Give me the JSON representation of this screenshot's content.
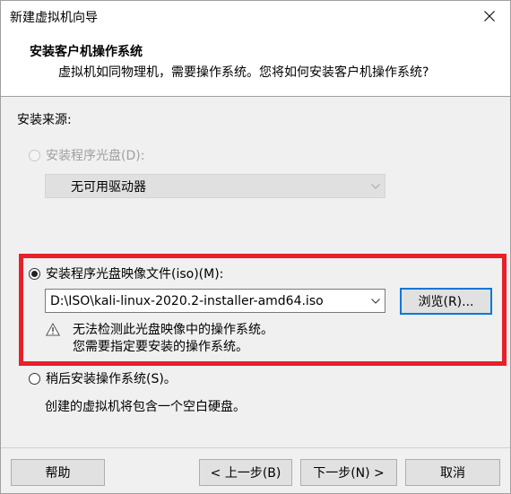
{
  "window": {
    "title": "新建虚拟机向导"
  },
  "header": {
    "title": "安装客户机操作系统",
    "description": "虚拟机如同物理机，需要操作系统。您将如何安装客户机操作系统?"
  },
  "source": {
    "label": "安装来源:",
    "disc_option": {
      "label": "安装程序光盘(D):",
      "selected": false,
      "enabled": false,
      "drive_value": "无可用驱动器"
    },
    "iso_option": {
      "label": "安装程序光盘映像文件(iso)(M):",
      "selected": true,
      "path_value": "D:\\ISO\\kali-linux-2020.2-installer-amd64.iso",
      "browse_label": "浏览(R)...",
      "warning_line1": "无法检测此光盘映像中的操作系统。",
      "warning_line2": "您需要指定要安装的操作系统。"
    },
    "later_option": {
      "label": "稍后安装操作系统(S)。",
      "selected": false,
      "note": "创建的虚拟机将包含一个空白硬盘。"
    }
  },
  "footer": {
    "help_label": "帮助",
    "back_label": "< 上一步(B)",
    "next_label": "下一步(N) >",
    "cancel_label": "取消"
  },
  "colors": {
    "highlight_box": "#e8202a",
    "focus_border": "#0078d7"
  }
}
